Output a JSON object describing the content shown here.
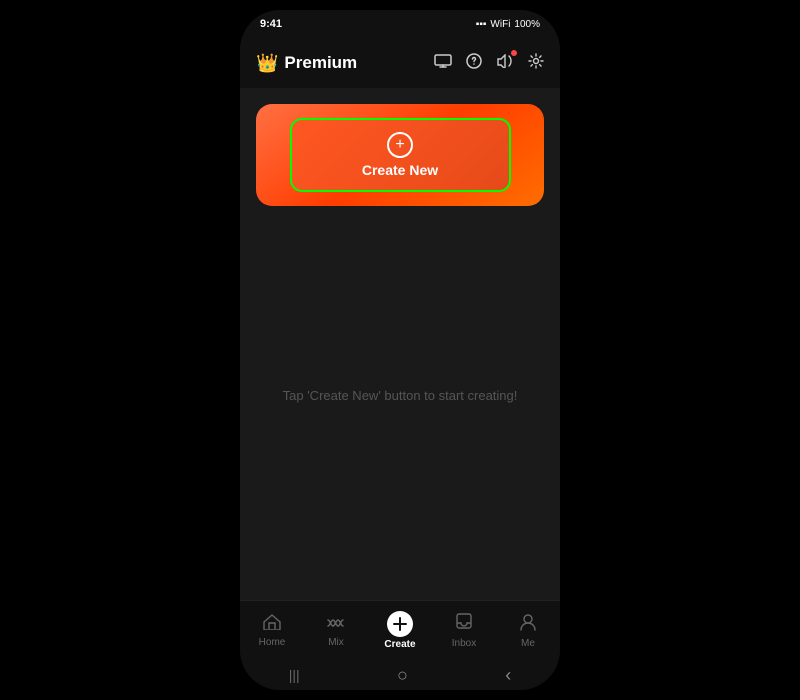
{
  "app": {
    "title": "Premium",
    "status_bar": {
      "time": "9:41",
      "battery": "100%"
    }
  },
  "header": {
    "crown_icon": "👑",
    "title": "Premium",
    "icons": {
      "screen": "🖥",
      "help": "?",
      "sound": "🔊",
      "settings": "⚙"
    }
  },
  "create_button": {
    "plus_symbol": "+",
    "label": "Create New"
  },
  "empty_state": {
    "message": "Tap 'Create New' button to start creating!"
  },
  "bottom_nav": {
    "items": [
      {
        "id": "home",
        "label": "Home",
        "icon": "⌂",
        "active": false
      },
      {
        "id": "mix",
        "label": "Mix",
        "icon": "∞",
        "active": false
      },
      {
        "id": "create",
        "label": "Create",
        "icon": "+",
        "active": true
      },
      {
        "id": "inbox",
        "label": "Inbox",
        "icon": "🔔",
        "active": false
      },
      {
        "id": "me",
        "label": "Me",
        "icon": "👤",
        "active": false
      }
    ]
  },
  "system_nav": {
    "menu": "|||",
    "home": "○",
    "back": "‹"
  },
  "colors": {
    "accent_green": "#00ff00",
    "button_orange": "#ff5722",
    "crown_gold": "#FFB800",
    "background_dark": "#1a1a1a",
    "nav_background": "#111111"
  }
}
